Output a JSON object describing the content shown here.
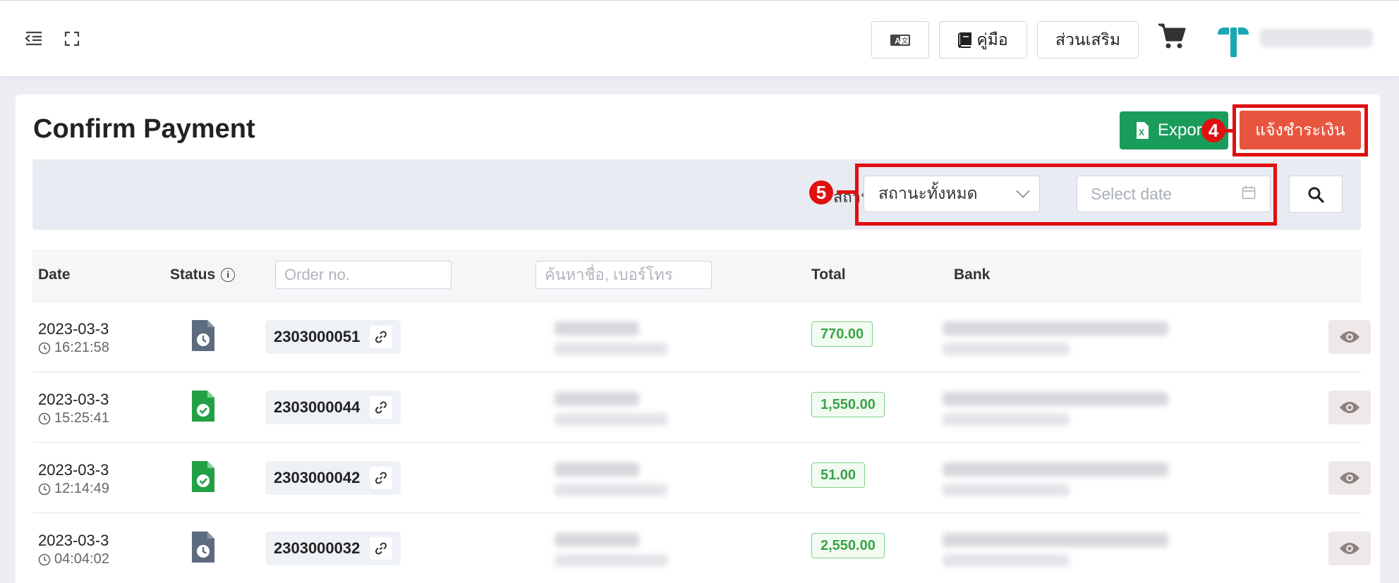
{
  "topbar": {
    "lang_button_label": "A 文",
    "manual_button_label": "คู่มือ",
    "addons_button_label": "ส่วนเสริม",
    "user_name": "■■■■■■ ■"
  },
  "page": {
    "title": "Confirm Payment",
    "export_label": "Export",
    "notify_payment_label": "แจ้งชำระเงิน",
    "badge_4": "4",
    "badge_5": "5"
  },
  "filters": {
    "label": "สถานะ",
    "status_value": "สถานะทั้งหมด",
    "date_placeholder": "Select date"
  },
  "table": {
    "headers": {
      "date": "Date",
      "status": "Status",
      "order_placeholder": "Order no.",
      "customer_placeholder": "ค้นหาชื่อ, เบอร์โทร",
      "total": "Total",
      "bank": "Bank"
    },
    "rows": [
      {
        "date": "2023-03-3",
        "time": "16:21:58",
        "status": "pending",
        "order_no": "2303000051",
        "total": "770.00"
      },
      {
        "date": "2023-03-3",
        "time": "15:25:41",
        "status": "confirmed",
        "order_no": "2303000044",
        "total": "1,550.00"
      },
      {
        "date": "2023-03-3",
        "time": "12:14:49",
        "status": "confirmed",
        "order_no": "2303000042",
        "total": "51.00"
      },
      {
        "date": "2023-03-3",
        "time": "04:04:02",
        "status": "pending",
        "order_no": "2303000032",
        "total": "2,550.00"
      }
    ]
  },
  "colors": {
    "export_green": "#1a9c5b",
    "notify_red": "#e8553f",
    "annotation_red": "#e01010",
    "pending_gray": "#5d6b7e",
    "confirmed_green": "#22a045",
    "total_green": "#3aa447",
    "logo_teal": "#1aa8b4"
  }
}
